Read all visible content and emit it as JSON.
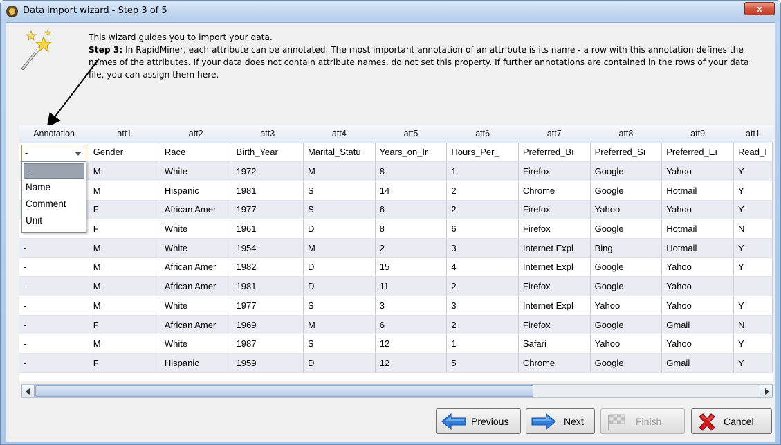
{
  "window": {
    "title": "Data import wizard - Step 3 of 5",
    "close_label": "x"
  },
  "intro": {
    "line1": "This wizard guides you to import your data.",
    "step_label": "Step 3:",
    "step_text": " In RapidMiner, each attribute can be annotated. The most important annotation of an attribute is its name - a row with this annotation defines the names of the attributes. If your data does not contain attribute names, do not set this property. If further annotations are contained in the rows of your data file, you can assign them here."
  },
  "grid": {
    "annotation_header": "Annotation",
    "columns": [
      "att1",
      "att2",
      "att3",
      "att4",
      "att5",
      "att6",
      "att7",
      "att8",
      "att9",
      "att1"
    ],
    "rows": [
      {
        "annotation": "-",
        "cells": [
          "Gender",
          "Race",
          "Birth_Year",
          "Marital_Statu",
          "Years_on_Ir",
          "Hours_Per_",
          "Preferred_Bı",
          "Preferred_Sı",
          "Preferred_Eı",
          "Read_I"
        ]
      },
      {
        "annotation": "-",
        "cells": [
          "M",
          "White",
          "1972",
          "M",
          "8",
          "1",
          "Firefox",
          "Google",
          "Yahoo",
          "Y"
        ]
      },
      {
        "annotation": "-",
        "cells": [
          "M",
          "Hispanic",
          "1981",
          "S",
          "14",
          "2",
          "Chrome",
          "Google",
          "Hotmail",
          "Y"
        ]
      },
      {
        "annotation": "-",
        "cells": [
          "F",
          "African Amer",
          "1977",
          "S",
          "6",
          "2",
          "Firefox",
          "Yahoo",
          "Yahoo",
          "Y"
        ]
      },
      {
        "annotation": "-",
        "cells": [
          "F",
          "White",
          "1961",
          "D",
          "8",
          "6",
          "Firefox",
          "Google",
          "Hotmail",
          "N"
        ]
      },
      {
        "annotation": "-",
        "cells": [
          "M",
          "White",
          "1954",
          "M",
          "2",
          "3",
          "Internet Expl",
          "Bing",
          "Hotmail",
          "Y"
        ]
      },
      {
        "annotation": "-",
        "cells": [
          "M",
          "African Amer",
          "1982",
          "D",
          "15",
          "4",
          "Internet Expl",
          "Google",
          "Yahoo",
          "Y"
        ]
      },
      {
        "annotation": "-",
        "cells": [
          "M",
          "African Amer",
          "1981",
          "D",
          "11",
          "2",
          "Firefox",
          "Google",
          "Yahoo",
          ""
        ]
      },
      {
        "annotation": "-",
        "cells": [
          "M",
          "White",
          "1977",
          "S",
          "3",
          "3",
          "Internet Expl",
          "Yahoo",
          "Yahoo",
          "Y"
        ]
      },
      {
        "annotation": "-",
        "cells": [
          "F",
          "African Amer",
          "1969",
          "M",
          "6",
          "2",
          "Firefox",
          "Google",
          "Gmail",
          "N"
        ]
      },
      {
        "annotation": "-",
        "cells": [
          "M",
          "White",
          "1987",
          "S",
          "12",
          "1",
          "Safari",
          "Yahoo",
          "Yahoo",
          "Y"
        ]
      },
      {
        "annotation": "-",
        "cells": [
          "F",
          "Hispanic",
          "1959",
          "D",
          "12",
          "5",
          "Chrome",
          "Google",
          "Gmail",
          "Y"
        ]
      }
    ]
  },
  "annotation_combo": {
    "value": "-",
    "options": [
      "-",
      "Name",
      "Comment",
      "Unit"
    ]
  },
  "buttons": {
    "previous": "Previous",
    "next": "Next",
    "finish": "Finish",
    "cancel": "Cancel"
  },
  "colors": {
    "selected_row": "#e9ecf2",
    "combo_border": "#e07a20",
    "close_button": "#d5573d",
    "arrow_blue": "#2f7fd8",
    "cancel_red": "#d01818"
  },
  "icons": [
    "wizard-wand-icon",
    "arrow-left-icon",
    "arrow-right-icon",
    "finish-flag-icon",
    "cancel-x-icon",
    "app-logo-icon"
  ]
}
